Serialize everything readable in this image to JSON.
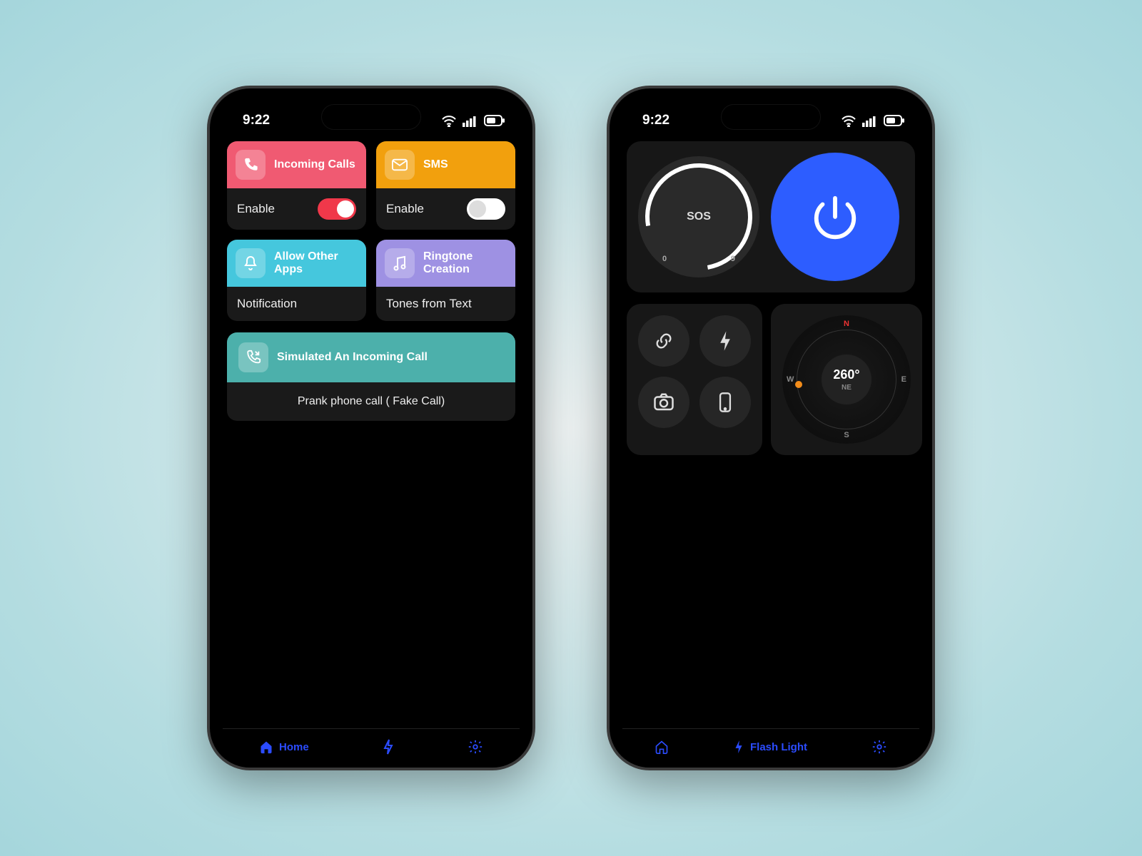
{
  "status": {
    "time": "9:22"
  },
  "phone1": {
    "cards": {
      "incoming": {
        "title": "Incoming Calls",
        "body": "Enable",
        "toggle": true
      },
      "sms": {
        "title": "SMS",
        "body": "Enable",
        "toggle": false
      },
      "allow": {
        "title": "Allow Other Apps",
        "body": "Notification"
      },
      "ringtone": {
        "title": "Ringtone Creation",
        "body": "Tones from Text"
      }
    },
    "simulated": {
      "title": "Simulated An Incoming Call",
      "body": "Prank phone call ( Fake Call)"
    },
    "nav": {
      "home": "Home"
    }
  },
  "phone2": {
    "sos": {
      "label": "SOS",
      "min": "0",
      "max": "9"
    },
    "compass": {
      "heading": "260°",
      "sub": "NE",
      "n": "N",
      "s": "S",
      "e": "E",
      "w": "W"
    },
    "nav": {
      "flash": "Flash Light"
    }
  }
}
